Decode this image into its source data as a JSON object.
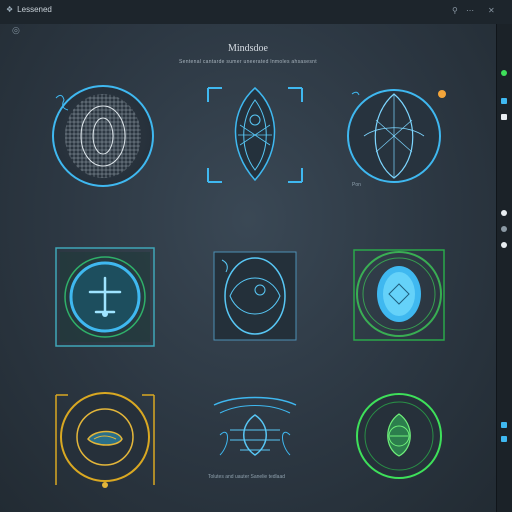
{
  "app": {
    "title": "Lessened"
  },
  "window_controls": {
    "icons": [
      "link-icon",
      "more-icon",
      "close-icon"
    ]
  },
  "board": {
    "title": "Mindsdoe",
    "subtitle": "Sentenal cantarde sumer uneerated lnmoles ahsasesnt"
  },
  "tiles": [
    {
      "name": "tile-woven-circle",
      "caption": ""
    },
    {
      "name": "tile-leaf-frame",
      "caption": ""
    },
    {
      "name": "tile-shell-circle",
      "caption": "Pon"
    },
    {
      "name": "tile-arrow-badge",
      "caption": ""
    },
    {
      "name": "tile-eye-frame",
      "caption": ""
    },
    {
      "name": "tile-green-gem",
      "caption": ""
    },
    {
      "name": "tile-gold-scroll",
      "caption": ""
    },
    {
      "name": "tile-blue-fan",
      "caption": "Tolutes and uauter Sanelie tedlaad"
    },
    {
      "name": "tile-green-ring",
      "caption": ""
    }
  ],
  "rightbar": {
    "items": [
      "color-swatch-green",
      "color-swatch-cyan",
      "color-swatch-white",
      "radio-1",
      "radio-2",
      "radio-3",
      "swatch-blue-1",
      "swatch-blue-2"
    ]
  },
  "colors": {
    "accent_cyan": "#3fb8f0",
    "accent_green": "#3ee05a",
    "accent_gold": "#d9a822",
    "background": "#2a3540"
  }
}
